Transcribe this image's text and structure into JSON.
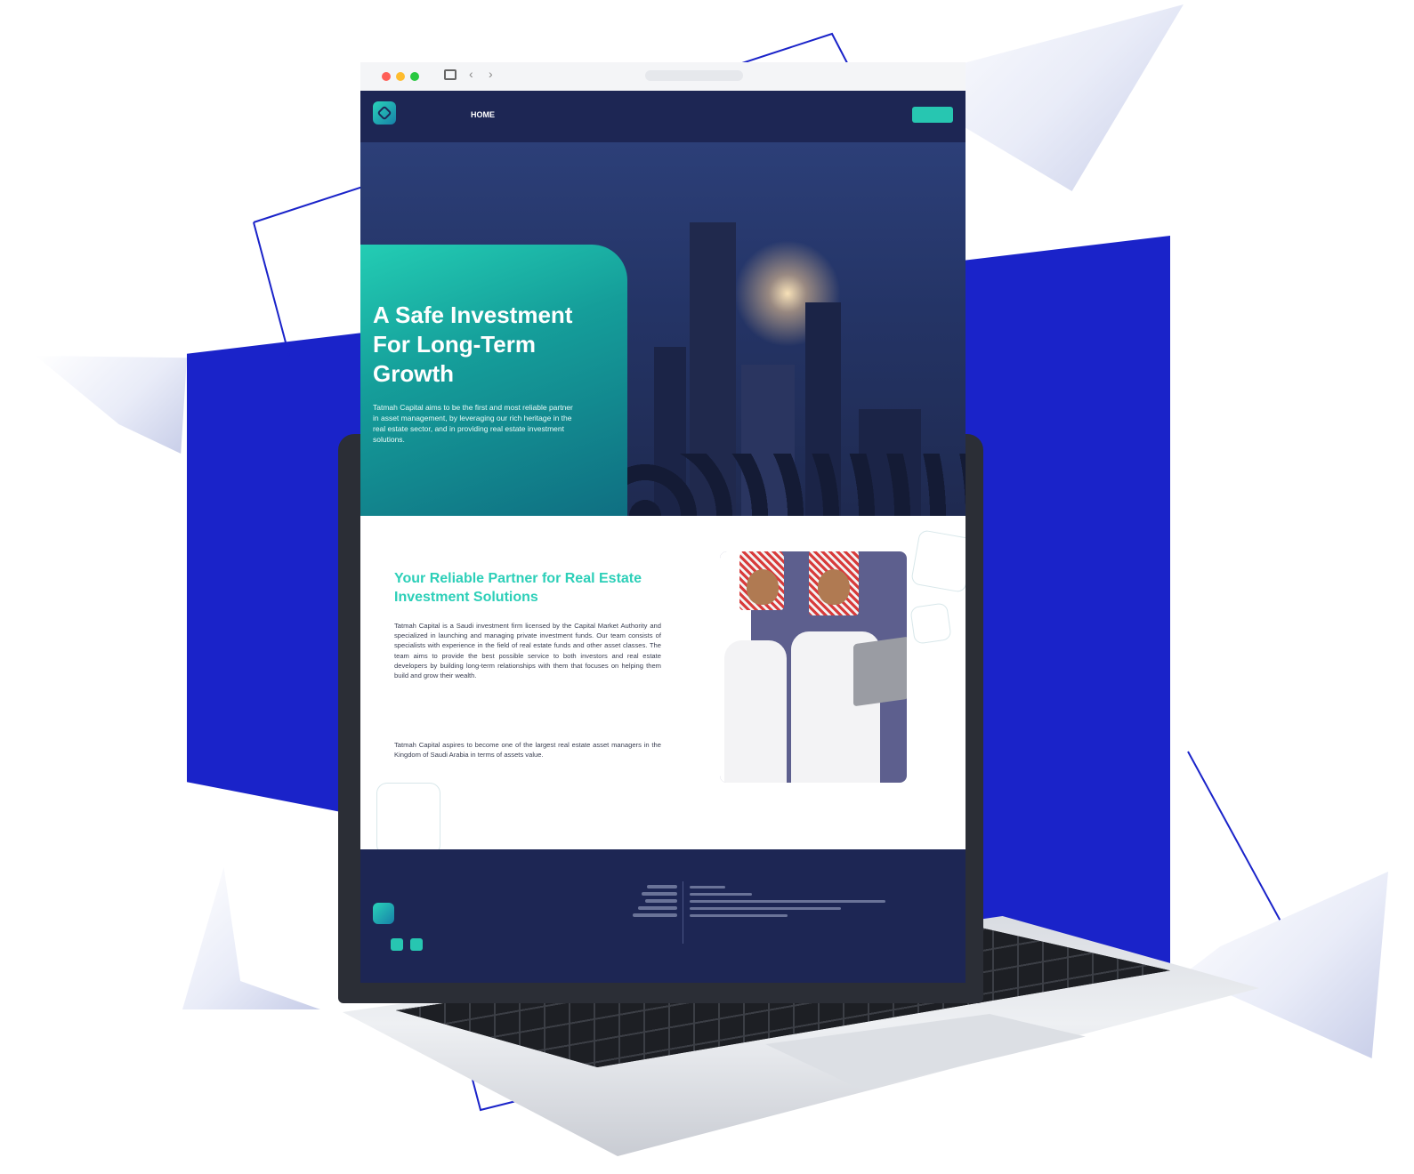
{
  "hero": {
    "title": "A Safe Investment For Long-Term Growth",
    "description": "Tatmah Capital aims to be the first and most reliable partner in asset management, by leveraging our rich heritage in the real estate sector, and in providing real estate investment solutions."
  },
  "about": {
    "title": "Your Reliable Partner for Real Estate Investment Solutions",
    "paragraph1": "Tatmah Capital is a Saudi investment firm licensed by the Capital Market Authority and specialized in launching and managing private investment funds. Our team consists of specialists with experience in the field of real estate funds and other asset classes. The team aims to provide the best possible service to both investors and real estate developers by building long-term relationships with them that focuses on helping them build and grow their wealth.",
    "paragraph2": "Tatmah Capital aspires to become one of the largest real estate asset managers in the Kingdom of Saudi Arabia in terms of assets value."
  },
  "nav": {
    "home": "HOME"
  },
  "icons": {
    "sidebar": "sidebar-icon",
    "back": "chevron-left-icon",
    "forward": "chevron-right-icon",
    "logo": "logo-mark-icon",
    "social1": "social-icon",
    "social2": "social-icon"
  },
  "colors": {
    "accent_blue": "#1a23c9",
    "navy": "#1d2654",
    "teal": "#27c6b1"
  }
}
